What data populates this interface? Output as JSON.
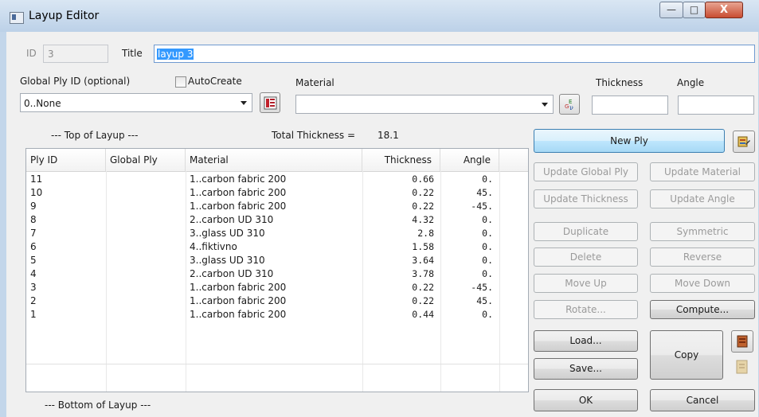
{
  "window": {
    "title": "Layup Editor",
    "min_glyph": "—",
    "max_glyph": "□",
    "close_glyph": "X"
  },
  "header": {
    "id_label": "ID",
    "id_value": "3",
    "title_label": "Title",
    "title_value": "layup 3",
    "global_ply_label": "Global Ply ID (optional)",
    "global_ply_value": "0..None",
    "autocreate_label": "AutoCreate",
    "autocreate_checked": false,
    "material_label": "Material",
    "material_value": "",
    "thickness_label": "Thickness",
    "thickness_value": "",
    "angle_label": "Angle",
    "angle_value": ""
  },
  "layup": {
    "top_label": "--- Top of Layup ---",
    "bottom_label": "--- Bottom of Layup ---",
    "total_thickness_label": "Total Thickness =",
    "total_thickness_value": "18.1",
    "columns": [
      "Ply ID",
      "Global Ply",
      "Material",
      "Thickness",
      "Angle"
    ],
    "rows": [
      [
        "11",
        "",
        "1..carbon fabric 200",
        "0.66",
        "0."
      ],
      [
        "10",
        "",
        "1..carbon fabric 200",
        "0.22",
        "45."
      ],
      [
        "9",
        "",
        "1..carbon fabric 200",
        "0.22",
        "-45."
      ],
      [
        "8",
        "",
        "2..carbon UD 310",
        "4.32",
        "0."
      ],
      [
        "7",
        "",
        "3..glass UD 310",
        "2.8",
        "0."
      ],
      [
        "6",
        "",
        "4..fiktivno",
        "1.58",
        "0."
      ],
      [
        "5",
        "",
        "3..glass UD 310",
        "3.64",
        "0."
      ],
      [
        "4",
        "",
        "2..carbon UD 310",
        "3.78",
        "0."
      ],
      [
        "3",
        "",
        "1..carbon fabric 200",
        "0.22",
        "-45."
      ],
      [
        "2",
        "",
        "1..carbon fabric 200",
        "0.22",
        "45."
      ],
      [
        "1",
        "",
        "1..carbon fabric 200",
        "0.44",
        "0."
      ]
    ]
  },
  "buttons": {
    "new_ply": "New Ply",
    "update_global_ply": "Update Global Ply",
    "update_material": "Update Material",
    "update_thickness": "Update Thickness",
    "update_angle": "Update Angle",
    "duplicate": "Duplicate",
    "symmetric": "Symmetric",
    "delete": "Delete",
    "reverse": "Reverse",
    "move_up": "Move Up",
    "move_down": "Move Down",
    "rotate": "Rotate...",
    "compute": "Compute...",
    "load": "Load...",
    "save": "Save...",
    "copy": "Copy",
    "ok": "OK",
    "cancel": "Cancel"
  },
  "icons": {
    "app": "window-app-icon",
    "global_ply_browse": "ply-stack-icon",
    "material_browse": "material-properties-icon",
    "new_ply_extra": "layup-edit-icon",
    "copy_icon_1": "copy-layup-icon",
    "copy_icon_2": "paste-layup-icon"
  }
}
